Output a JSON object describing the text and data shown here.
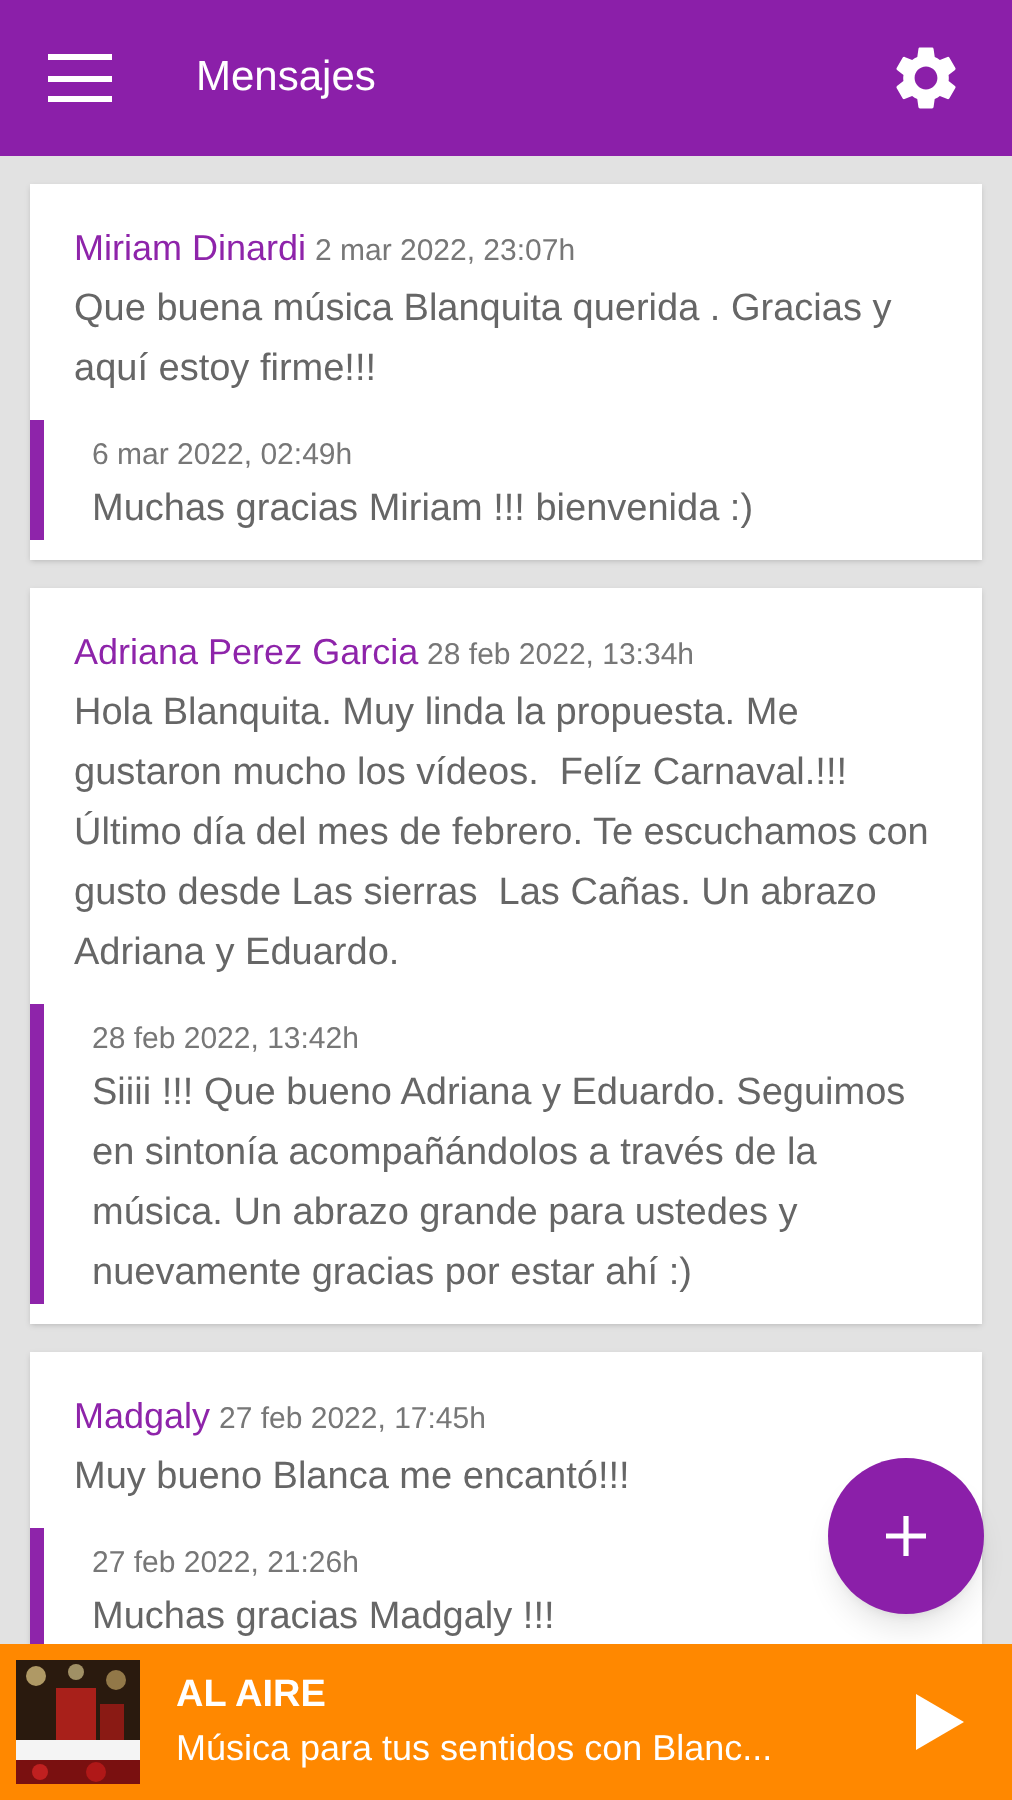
{
  "header": {
    "title": "Mensajes"
  },
  "messages": [
    {
      "author": "Miriam Dinardi",
      "date": "2 mar 2022, 23:07h",
      "text": "Que buena música Blanquita querida . Gracias y aquí estoy firme!!!",
      "reply": {
        "date": "6 mar 2022, 02:49h",
        "text": "Muchas gracias Miriam !!! bienvenida :)"
      }
    },
    {
      "author": "Adriana Perez Garcia",
      "date": "28 feb 2022, 13:34h",
      "text": "Hola Blanquita. Muy linda la propuesta. Me gustaron mucho los vídeos.  Felíz Carnaval.!!! Último día del mes de febrero. Te escuchamos con gusto desde Las sierras  Las Cañas. Un abrazo Adriana y Eduardo.",
      "reply": {
        "date": "28 feb 2022, 13:42h",
        "text": "Siiii !!! Que bueno Adriana y Eduardo. Seguimos en sintonía acompañándolos a través de la música. Un abrazo grande para ustedes y nuevamente gracias por estar ahí :)"
      }
    },
    {
      "author": "Madgaly",
      "date": "27 feb 2022, 17:45h",
      "text": "Muy bueno Blanca me encantó!!!",
      "reply": {
        "date": "27 feb 2022, 21:26h",
        "text": "Muchas gracias Madgaly !!!"
      }
    }
  ],
  "player": {
    "label": "AL AIRE",
    "program": "Música para tus sentidos con Blanc..."
  }
}
